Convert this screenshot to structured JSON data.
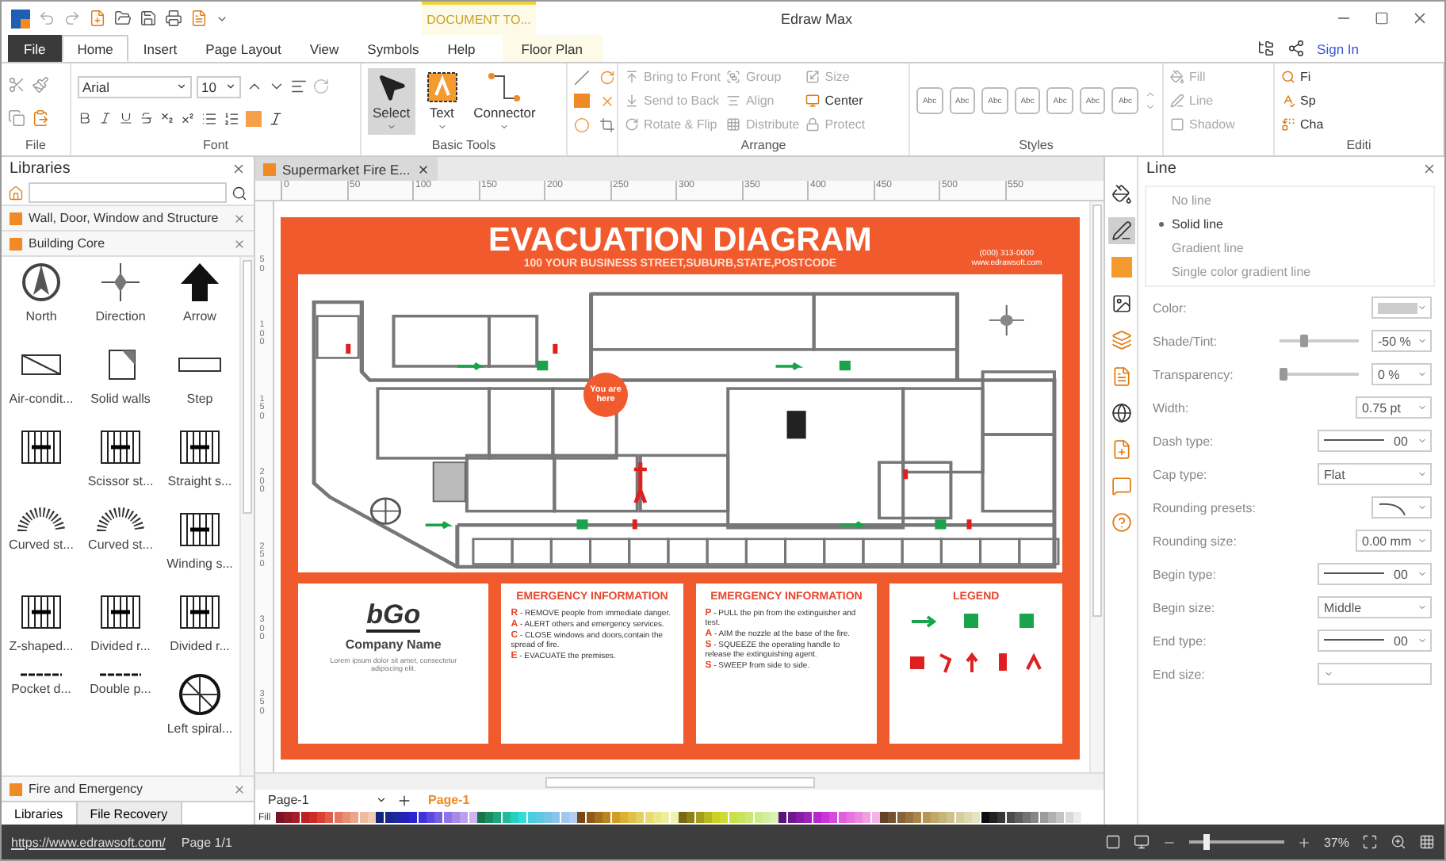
{
  "window": {
    "title": "Edraw Max",
    "context_tab": "DOCUMENT TO..."
  },
  "menu_tabs": [
    {
      "label": "File",
      "kind": "file",
      "selected": false
    },
    {
      "label": "Home",
      "kind": "tab",
      "selected": true
    },
    {
      "label": "Insert",
      "kind": "tab",
      "selected": false
    },
    {
      "label": "Page Layout",
      "kind": "tab",
      "selected": false
    },
    {
      "label": "View",
      "kind": "tab",
      "selected": false
    },
    {
      "label": "Symbols",
      "kind": "tab",
      "selected": false
    },
    {
      "label": "Help",
      "kind": "tab",
      "selected": false
    },
    {
      "label": "Floor Plan",
      "kind": "context",
      "selected": false
    }
  ],
  "account": {
    "sign_in": "Sign In"
  },
  "ribbon": {
    "file_group": {
      "label": "File"
    },
    "font_group": {
      "font": "Arial",
      "size": "10",
      "label": "Font"
    },
    "basic_tools": {
      "label": "Basic Tools",
      "tools": [
        {
          "label": "Select",
          "kind": "pointer",
          "selected": true
        },
        {
          "label": "Text",
          "kind": "text",
          "selected": false
        },
        {
          "label": "Connector",
          "kind": "connector",
          "selected": false
        }
      ]
    },
    "arrange": {
      "label": "Arrange",
      "items": [
        {
          "label": "Bring to Front",
          "disabled": true
        },
        {
          "label": "Send to Back",
          "disabled": true
        },
        {
          "label": "Rotate & Flip",
          "disabled": true
        },
        {
          "label": "Group",
          "disabled": true
        },
        {
          "label": "Align",
          "disabled": true
        },
        {
          "label": "Distribute",
          "disabled": true
        },
        {
          "label": "Size",
          "disabled": true
        },
        {
          "label": "Center",
          "disabled": false
        },
        {
          "label": "Protect",
          "disabled": true
        }
      ]
    },
    "styles": {
      "label": "Styles",
      "swatches": [
        "Abc",
        "Abc",
        "Abc",
        "Abc",
        "Abc",
        "Abc",
        "Abc"
      ]
    },
    "format": [
      {
        "label": "Fill",
        "disabled": true
      },
      {
        "label": "Line",
        "disabled": true
      },
      {
        "label": "Shadow",
        "disabled": true
      }
    ],
    "editing": {
      "label": "Editi",
      "items": [
        "Fi",
        "Sp",
        "Cha"
      ]
    }
  },
  "libraries": {
    "title": "Libraries",
    "categories": [
      "Wall, Door, Window and Structure",
      "Building Core"
    ],
    "shapes": [
      {
        "label": "North",
        "kind": "compass"
      },
      {
        "label": "Direction",
        "kind": "direction"
      },
      {
        "label": "Arrow",
        "kind": "arrow"
      },
      {
        "label": "Air-condit...",
        "kind": "box"
      },
      {
        "label": "Solid walls",
        "kind": "corner"
      },
      {
        "label": "Step",
        "kind": "bar"
      },
      {
        "kind": "stairs"
      },
      {
        "label": "Scissor st...",
        "kind": "stairs"
      },
      {
        "label": "Straight s...",
        "kind": "stairs"
      },
      {
        "label": "Curved st...",
        "kind": "curve"
      },
      {
        "label": "Curved st...",
        "kind": "curve"
      },
      {
        "label": "Winding s...",
        "kind": "stairs"
      },
      {
        "label": "Z-shaped...",
        "kind": "stairs"
      },
      {
        "label": "Divided r...",
        "kind": "stairs"
      },
      {
        "label": "Divided r...",
        "kind": "stairs"
      },
      {
        "label": "Pocket d...",
        "kind": "door"
      },
      {
        "label": "Double p...",
        "kind": "door"
      },
      {
        "label": "Left spiral...",
        "kind": "spiral"
      }
    ],
    "bottom_category": "Fire and Emergency",
    "tabs": [
      {
        "label": "Libraries",
        "selected": true
      },
      {
        "label": "File Recovery",
        "selected": false
      }
    ]
  },
  "document": {
    "tab": "Supermarket Fire E...",
    "ruler": [
      "0",
      "50",
      "100",
      "150",
      "200",
      "250",
      "300",
      "350",
      "400",
      "450",
      "500",
      "550"
    ],
    "vertical_ruler": [
      "50",
      "100",
      "150",
      "200",
      "250",
      "300",
      "350"
    ],
    "diagram": {
      "title": "EVACUATION DIAGRAM",
      "subtitle": "100 YOUR BUSINESS STREET,SUBURB,STATE,POSTCODE",
      "phone": "(000) 313-0000",
      "website": "www.edrawsoft.com",
      "marker": "You are here",
      "company": {
        "logo": "bGo",
        "name": "Company Name",
        "text": "Lorem ipsum dolor sit amet, consectetur adipiscing elit."
      },
      "info_cards": [
        {
          "title": "EMERGENCY INFORMATION",
          "steps": [
            {
              "letter": "R",
              "text": " - REMOVE people from immediate danger."
            },
            {
              "letter": "A",
              "text": " - ALERT others and emergency services."
            },
            {
              "letter": "C",
              "text": " - CLOSE windows and doors,contain the spread of fire."
            },
            {
              "letter": "E",
              "text": " - EVACUATE the premises."
            }
          ]
        },
        {
          "title": "EMERGENCY INFORMATION",
          "steps": [
            {
              "letter": "P",
              "text": " - PULL the pin from the extinguisher and test."
            },
            {
              "letter": "A",
              "text": " - AIM the nozzle at the base of the fire."
            },
            {
              "letter": "S",
              "text": " - SQUEEZE the operating handle to release the extinguishing agent."
            },
            {
              "letter": "S",
              "text": " - SWEEP from side to side."
            }
          ]
        }
      ],
      "legend": {
        "title": "LEGEND"
      }
    },
    "page_bar": {
      "current": "Page-1",
      "tabs": [
        {
          "label": "Page-1",
          "selected": true
        }
      ]
    },
    "fill_label": "Fill"
  },
  "side_tools": [
    {
      "kind": "fill",
      "selected": false
    },
    {
      "kind": "line",
      "selected": true
    },
    {
      "kind": "shadow",
      "selected": false
    },
    {
      "kind": "image",
      "selected": false
    },
    {
      "kind": "layers",
      "selected": false
    },
    {
      "kind": "page",
      "selected": false
    },
    {
      "kind": "globe",
      "selected": false
    },
    {
      "kind": "doc",
      "selected": false
    },
    {
      "kind": "comment",
      "selected": false
    },
    {
      "kind": "help",
      "selected": false
    }
  ],
  "line_panel": {
    "title": "Line",
    "line_types": [
      {
        "label": "No line",
        "selected": false
      },
      {
        "label": "Solid line",
        "selected": true
      },
      {
        "label": "Gradient line",
        "selected": false
      },
      {
        "label": "Single color gradient line",
        "selected": false
      }
    ],
    "properties": [
      {
        "label": "Color:",
        "kind": "color"
      },
      {
        "label": "Shade/Tint:",
        "kind": "slider",
        "level": 0.25,
        "value": "-50 %"
      },
      {
        "label": "Transparency:",
        "kind": "slider",
        "level": 0,
        "value": "0 %"
      },
      {
        "label": "Width:",
        "kind": "spin",
        "value": "0.75 pt"
      },
      {
        "label": "Dash type:",
        "kind": "line",
        "value": "00"
      },
      {
        "label": "Cap type:",
        "kind": "select",
        "value": "Flat"
      },
      {
        "label": "Rounding presets:",
        "kind": "curve"
      },
      {
        "label": "Rounding size:",
        "kind": "spin",
        "value": "0.00 mm"
      },
      {
        "label": "Begin type:",
        "kind": "line",
        "value": "00"
      },
      {
        "label": "Begin size:",
        "kind": "select",
        "value": "Middle"
      },
      {
        "label": "End type:",
        "kind": "line",
        "value": "00"
      },
      {
        "label": "End size:",
        "kind": "select"
      }
    ]
  },
  "status_bar": {
    "link": "https://www.edrawsoft.com/",
    "page": "Page 1/1",
    "zoom": {
      "level": 0.15,
      "label": "37%"
    }
  }
}
